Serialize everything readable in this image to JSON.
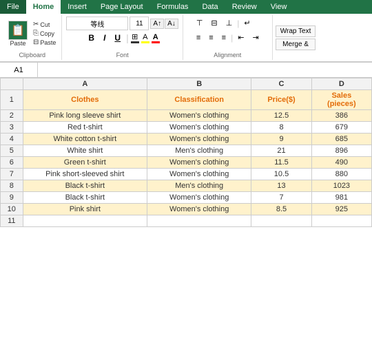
{
  "tabs": [
    "File",
    "Home",
    "Insert",
    "Page Layout",
    "Formulas",
    "Data",
    "Review",
    "View"
  ],
  "active_tab": "Home",
  "ribbon": {
    "font_name": "等线",
    "font_size": "11",
    "clipboard_label": "Clipboard",
    "font_label": "Font",
    "alignment_label": "Alignment",
    "wrap_text": "Wrap Text",
    "merge": "Merge &"
  },
  "cell_ref": "A1",
  "formula_value": "",
  "columns": [
    "A",
    "B",
    "C",
    "D"
  ],
  "headers": {
    "row": "",
    "a": "Clothes",
    "b": "Classification",
    "c": "Price($)",
    "d": "Sales\n(pieces)"
  },
  "rows": [
    {
      "num": "2",
      "a": "Pink long sleeve shirt",
      "b": "Women's clothing",
      "c": "12.5",
      "d": "386"
    },
    {
      "num": "3",
      "a": "Red t-shirt",
      "b": "Women's clothing",
      "c": "8",
      "d": "679"
    },
    {
      "num": "4",
      "a": "White cotton t-shirt",
      "b": "Women's clothing",
      "c": "9",
      "d": "685"
    },
    {
      "num": "5",
      "a": "White shirt",
      "b": "Men's clothing",
      "c": "21",
      "d": "896"
    },
    {
      "num": "6",
      "a": "Green t-shirt",
      "b": "Women's clothing",
      "c": "11.5",
      "d": "490"
    },
    {
      "num": "7",
      "a": "Pink short-sleeved shirt",
      "b": "Women's clothing",
      "c": "10.5",
      "d": "880"
    },
    {
      "num": "8",
      "a": "Black t-shirt",
      "b": "Men's clothing",
      "c": "13",
      "d": "1023"
    },
    {
      "num": "9",
      "a": "Black t-shirt",
      "b": "Women's clothing",
      "c": "7",
      "d": "981"
    },
    {
      "num": "10",
      "a": "Pink shirt",
      "b": "Women's clothing",
      "c": "8.5",
      "d": "925"
    },
    {
      "num": "11",
      "a": "",
      "b": "",
      "c": "",
      "d": ""
    }
  ]
}
